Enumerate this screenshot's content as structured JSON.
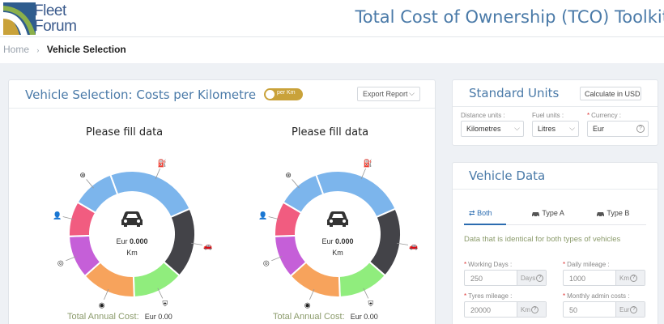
{
  "header": {
    "logo_line1": "Fleet",
    "logo_line2": "Forum",
    "app_title": "Total Cost of Ownership (TCO) Toolkit"
  },
  "breadcrumb": {
    "home": "Home",
    "separator": "›",
    "current": "Vehicle Selection"
  },
  "selection_card": {
    "title": "Vehicle Selection: Costs per Kilometre",
    "toggle_label": "per Km",
    "export_label": "Export Report",
    "charts": [
      {
        "heading": "Please fill data",
        "currency": "Eur",
        "value": "0.000",
        "unit": "Km",
        "total_label": "Total Annual Cost:",
        "total_value": "Eur  0.00"
      },
      {
        "heading": "Please fill data",
        "currency": "Eur",
        "value": "0.000",
        "unit": "Km",
        "total_label": "Total Annual Cost:",
        "total_value": "Eur  0.00"
      }
    ]
  },
  "chart_data": {
    "type": "pie",
    "categories": [
      "fuel",
      "maintenance",
      "insurance",
      "depreciation",
      "tyres",
      "driver",
      "other"
    ],
    "values": [
      24,
      18,
      13,
      14,
      11,
      9,
      11
    ],
    "colors": [
      "#7cb5ec",
      "#434348",
      "#90ed7d",
      "#f7a35c",
      "#c55fd8",
      "#f15c80",
      "#7cb5ec"
    ],
    "icons": [
      "fuel-pump-icon",
      "car-repair-icon",
      "shield-icon",
      "coin-icon",
      "tyre-icon",
      "driver-icon",
      "steering-icon"
    ]
  },
  "units_card": {
    "title": "Standard Units",
    "calc_label": "Calculate in USD",
    "fields": [
      {
        "label": "Distance units :",
        "value": "Kilometres",
        "required": false
      },
      {
        "label": "Fuel units :",
        "value": "Litres",
        "required": false
      },
      {
        "label": "Currency :",
        "value": "Eur",
        "required": true
      }
    ]
  },
  "vehicle_card": {
    "title": "Vehicle Data",
    "tabs": [
      {
        "label": "Both",
        "icon": "swap-arrows-icon"
      },
      {
        "label": "Type A",
        "icon": "car-icon"
      },
      {
        "label": "Type B",
        "icon": "car-icon"
      }
    ],
    "identical_text": "Data that is identical for both types of vehicles",
    "fields": [
      {
        "label": "Working Days :",
        "value": "250",
        "unit": "Days"
      },
      {
        "label": "Daily mileage :",
        "value": "1000",
        "unit": "Km"
      },
      {
        "label": "Tyres mileage :",
        "value": "20000",
        "unit": "Km"
      },
      {
        "label": "Monthly admin costs :",
        "value": "50",
        "unit": "Eur"
      }
    ]
  },
  "colors": {
    "accent_blue": "#4a7aa8",
    "toggle_gold": "#c9a23a",
    "tab_active": "#2b6cb0",
    "olive_text": "#8a9a6a"
  }
}
